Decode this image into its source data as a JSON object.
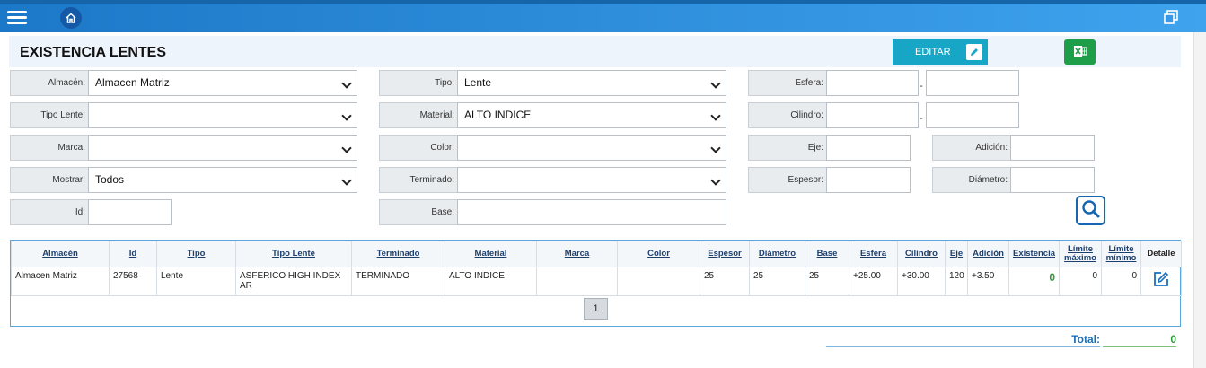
{
  "header": {
    "menu_icon": "hamburger-menu-icon",
    "home_icon": "home-icon",
    "restore_icon": "window-restore-icon"
  },
  "page": {
    "title": "EXISTENCIA LENTES",
    "edit_label": "EDITAR",
    "edit_icon": "pencil-icon",
    "excel_icon": "excel-icon"
  },
  "filters": {
    "almacen": {
      "label": "Almacén:",
      "value": "Almacen Matriz"
    },
    "tipo": {
      "label": "Tipo:",
      "value": "Lente"
    },
    "esfera": {
      "label": "Esfera:",
      "from": "",
      "to": "",
      "separator": "-"
    },
    "tipo_lente": {
      "label": "Tipo Lente:",
      "value": ""
    },
    "material": {
      "label": "Material:",
      "value": "ALTO INDICE"
    },
    "cilindro": {
      "label": "Cilindro:",
      "from": "",
      "to": "",
      "separator": "-"
    },
    "marca": {
      "label": "Marca:",
      "value": ""
    },
    "color": {
      "label": "Color:",
      "value": ""
    },
    "eje": {
      "label": "Eje:",
      "value": ""
    },
    "adicion": {
      "label": "Adición:",
      "value": ""
    },
    "mostrar": {
      "label": "Mostrar:",
      "value": "Todos"
    },
    "terminado": {
      "label": "Terminado:",
      "value": ""
    },
    "espesor": {
      "label": "Espesor:",
      "value": ""
    },
    "diametro": {
      "label": "Diámetro:",
      "value": ""
    },
    "id": {
      "label": "Id:",
      "value": ""
    },
    "base": {
      "label": "Base:",
      "value": ""
    },
    "search_icon": "search-icon"
  },
  "table": {
    "headers": [
      "Almacén",
      "Id",
      "Tipo",
      "Tipo Lente",
      "Terminado",
      "Material",
      "Marca",
      "Color",
      "Espesor",
      "Diámetro",
      "Base",
      "Esfera",
      "Cilindro",
      "Eje",
      "Adición",
      "Existencia",
      "Límite máximo",
      "Límite mínimo",
      "Detalle"
    ],
    "rows": [
      {
        "almacen": "Almacen Matriz",
        "id": "27568",
        "tipo": "Lente",
        "tipo_lente": "ASFERICO HIGH INDEX AR",
        "terminado": "TERMINADO",
        "material": "ALTO INDICE",
        "marca": "",
        "color": "",
        "espesor": "25",
        "diametro": "25",
        "base": "25",
        "esfera": "+25.00",
        "cilindro": "+30.00",
        "eje": "120",
        "adicion": "+3.50",
        "existencia": "0",
        "limite_maximo": "0",
        "limite_minimo": "0",
        "detalle_icon": "edit-icon"
      }
    ],
    "page": "1"
  },
  "footer": {
    "total_label": "Total:",
    "total_value": "0"
  }
}
